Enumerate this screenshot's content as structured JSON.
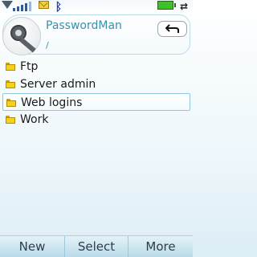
{
  "status_bar": {
    "signal_icon": "signal-triangle-icon",
    "bars_icon": "signal-bars-icon",
    "mail_icon": "envelope-icon",
    "bluetooth_icon": "bluetooth-icon",
    "battery_icon": "battery-icon",
    "data_icon": "data-transfer-icon"
  },
  "header": {
    "app_title": "PasswordMan",
    "path": "/",
    "avatar_icon": "key-icon",
    "back_icon": "back-arrow-icon"
  },
  "folders": [
    {
      "label": "Ftp",
      "selected": false
    },
    {
      "label": "Server admin",
      "selected": false
    },
    {
      "label": "Web logins",
      "selected": true
    },
    {
      "label": "Work",
      "selected": false
    }
  ],
  "softkeys": {
    "left": "New",
    "middle": "Select",
    "right": "More"
  },
  "colors": {
    "accent": "#3a8fab",
    "selection_border": "#8ec9df",
    "softkey_bg": "#b9dbe9",
    "folder": "#f4d21a"
  }
}
